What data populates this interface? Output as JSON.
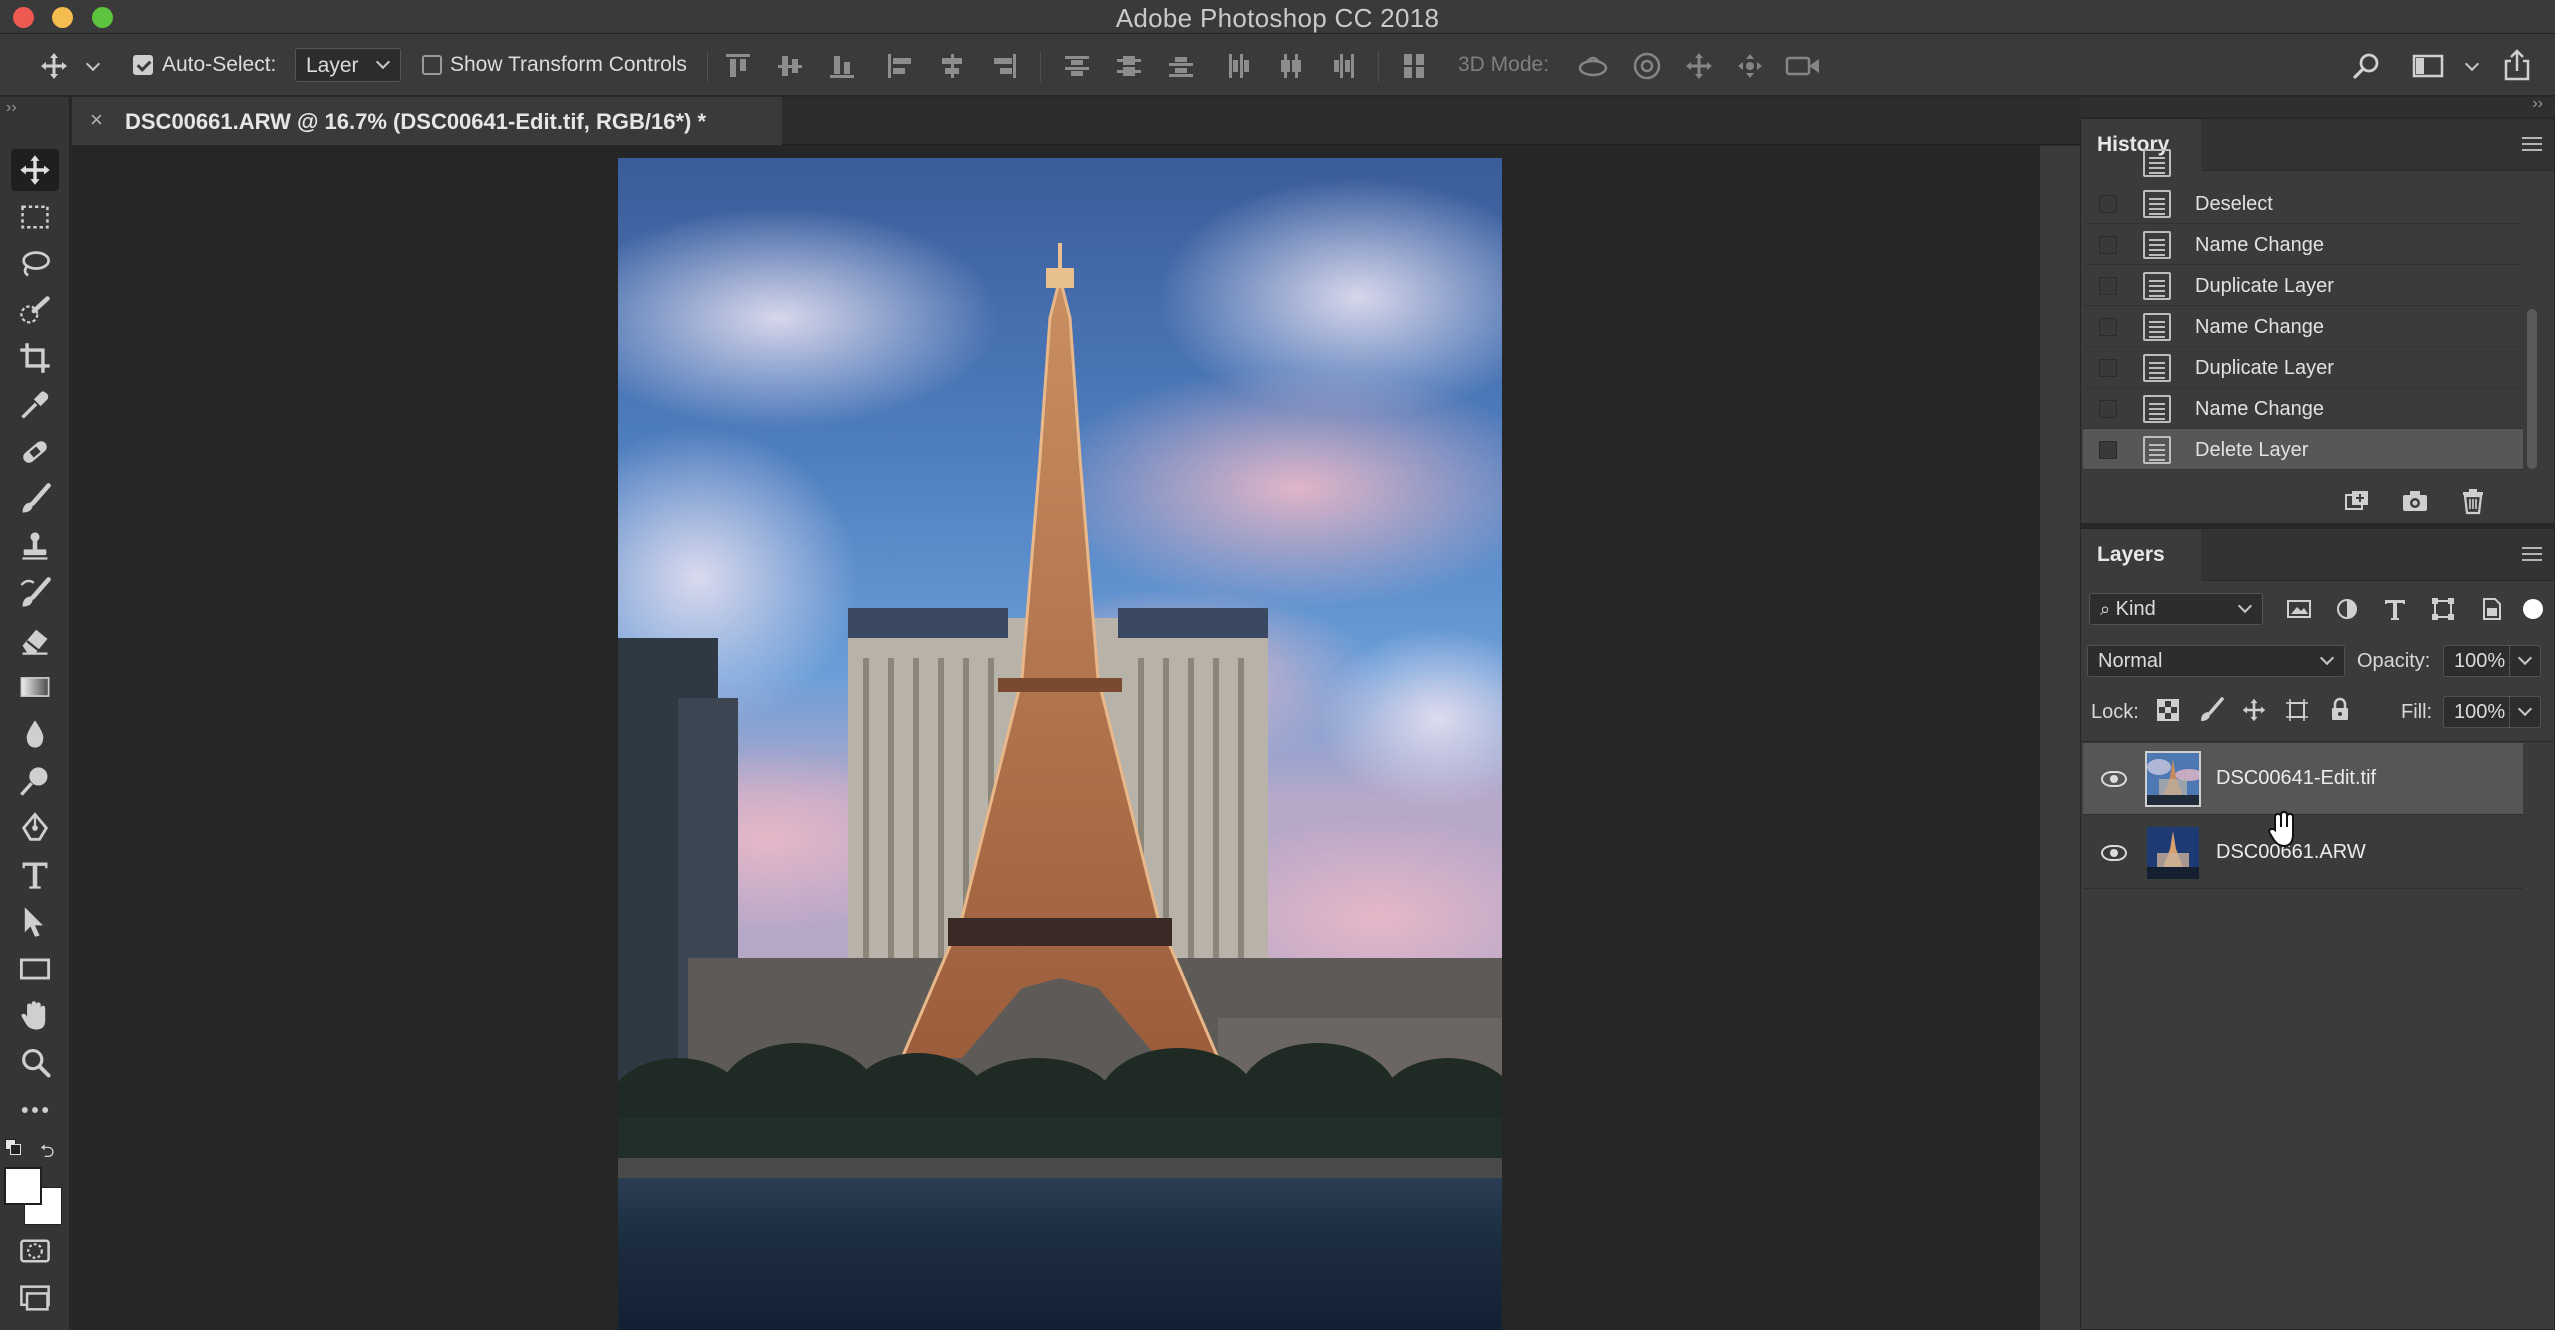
{
  "window": {
    "title": "Adobe Photoshop CC 2018"
  },
  "options_bar": {
    "auto_select_label": "Auto-Select:",
    "auto_select_checked": true,
    "auto_select_value": "Layer",
    "show_transform_label": "Show Transform Controls",
    "show_transform_checked": false,
    "mode_3d_label": "3D Mode:"
  },
  "document": {
    "tab_title": "DSC00661.ARW @ 16.7% (DSC00641-Edit.tif, RGB/16*) *",
    "close_glyph": "×"
  },
  "history": {
    "title": "History",
    "items": [
      {
        "label": "Deselect"
      },
      {
        "label": "Name Change"
      },
      {
        "label": "Duplicate Layer"
      },
      {
        "label": "Name Change"
      },
      {
        "label": "Duplicate Layer"
      },
      {
        "label": "Name Change"
      },
      {
        "label": "Delete Layer",
        "selected": true
      }
    ]
  },
  "layers": {
    "title": "Layers",
    "filter_kind": "Kind",
    "blend_mode": "Normal",
    "opacity_label": "Opacity:",
    "opacity_value": "100%",
    "lock_label": "Lock:",
    "fill_label": "Fill:",
    "fill_value": "100%",
    "items": [
      {
        "name": "DSC00641-Edit.tif",
        "selected": true,
        "visible": true
      },
      {
        "name": "DSC00661.ARW",
        "selected": false,
        "visible": true
      }
    ]
  },
  "colors": {
    "ui_bg": "#3a3a3a",
    "canvas_bg": "#262626",
    "panel_bg": "#3b3b3b",
    "selected_row": "#575757",
    "close": "#ee5a52",
    "minimize": "#f5bd4f",
    "maximize": "#5ec43f"
  }
}
